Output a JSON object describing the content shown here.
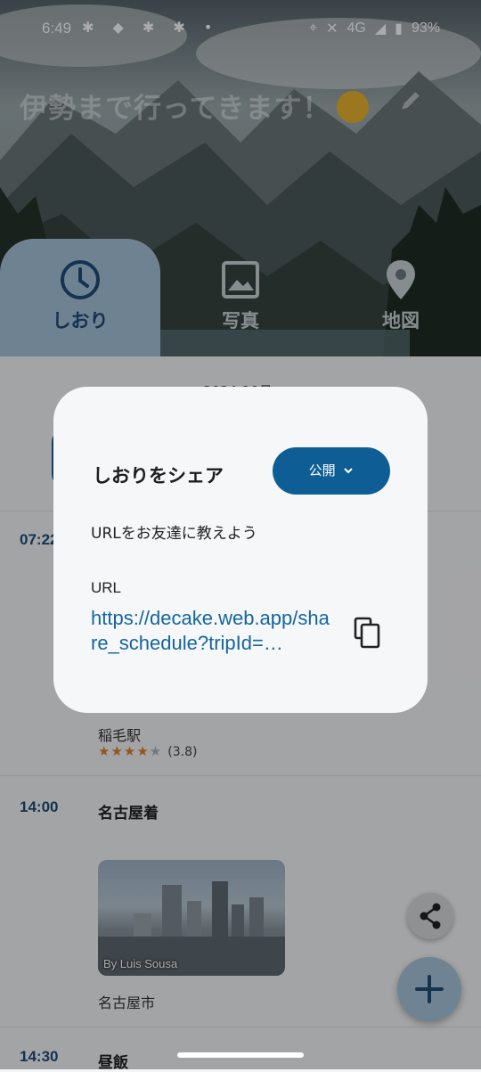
{
  "status_bar": {
    "time": "6:49",
    "left_icons": [
      "slack-icon",
      "discord-icon",
      "slack-icon",
      "slack-icon",
      "dot-icon"
    ],
    "network": "4G",
    "battery": "93%"
  },
  "header": {
    "trip_title": "伊勢まで行ってきます！"
  },
  "tabs": [
    {
      "label": "しおり",
      "icon": "clock-icon",
      "active": true
    },
    {
      "label": "写真",
      "icon": "image-icon",
      "active": false
    },
    {
      "label": "地図",
      "icon": "map-pin-icon",
      "active": false
    }
  ],
  "schedule": {
    "date": "2024-10月",
    "rows": [
      {
        "time": "07:22",
        "title": "",
        "place": "稲毛駅",
        "rating": "(3.8)",
        "stars": 4
      },
      {
        "time": "14:00",
        "title": "名古屋着",
        "place": "名古屋市",
        "photo_credit": "By Luis Sousa"
      },
      {
        "time": "14:30",
        "title": "昼飯"
      }
    ]
  },
  "dialog": {
    "title": "しおりをシェア",
    "visibility_label": "公開",
    "subtitle": "URLをお友達に教えよう",
    "url_label": "URL",
    "url": "https://decake.web.app/share_schedule?tripId=…"
  },
  "colors": {
    "accent": "#0e5e95",
    "tab_active": "#a6c2d9",
    "link": "#13669d",
    "star": "#d9822b"
  }
}
